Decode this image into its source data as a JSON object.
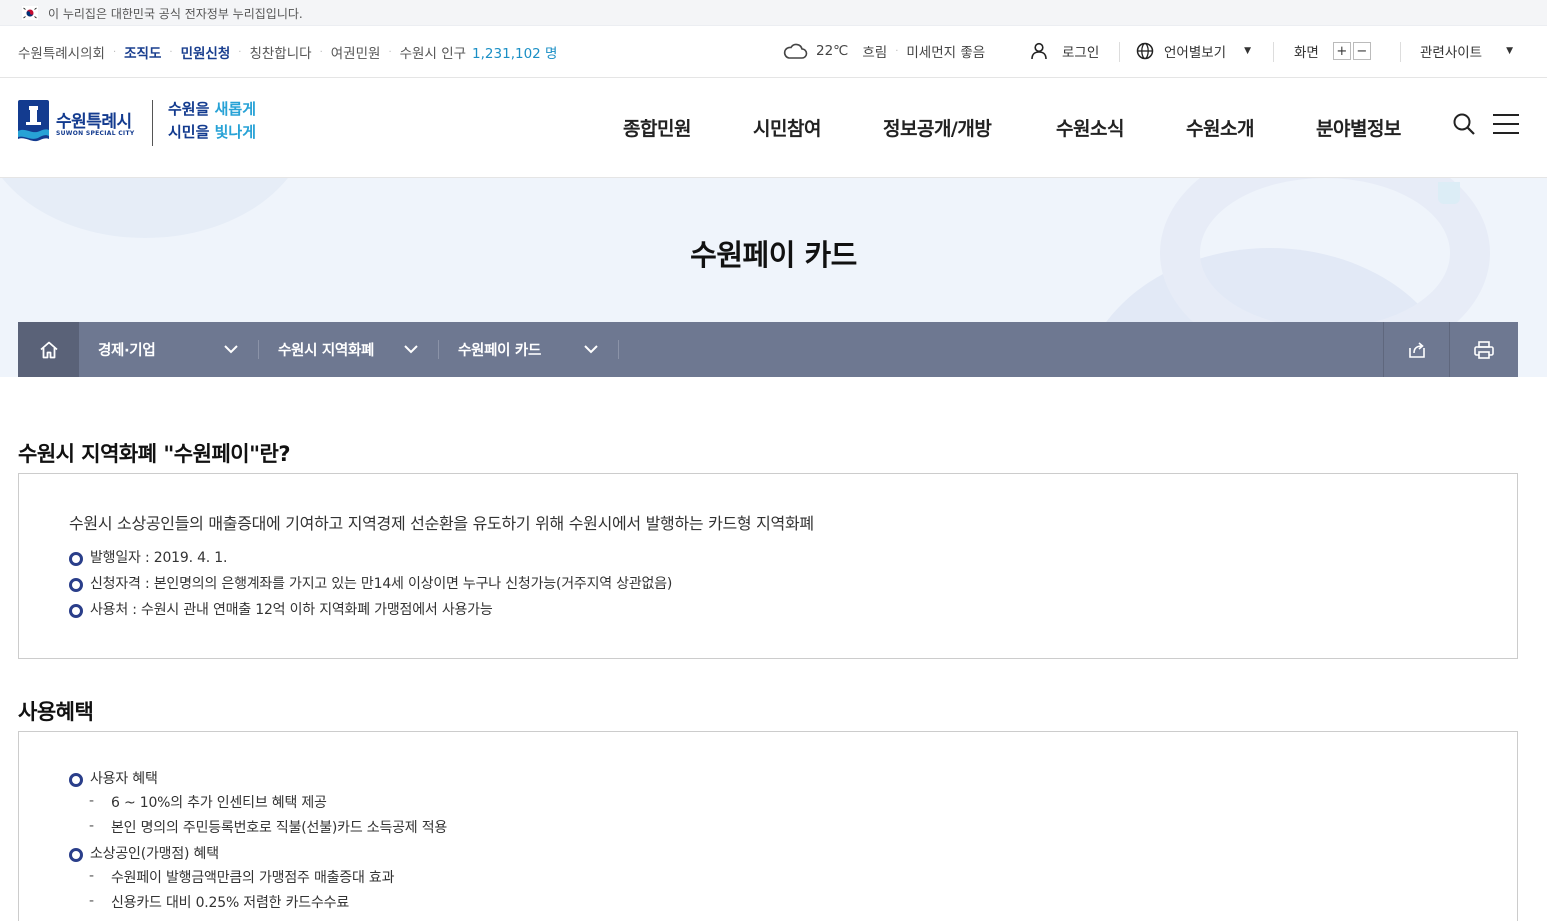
{
  "gov_banner": {
    "text": "이 누리집은 대한민국 공식 전자정부 누리집입니다."
  },
  "util": {
    "council": "수원특례시의회",
    "org_chart": "조직도",
    "civil_apply": "민원신청",
    "praise": "칭찬합니다",
    "passport": "여권민원",
    "population_label": "수원시 인구",
    "population_value": "1,231,102 명",
    "temperature": "22℃",
    "sky": "흐림",
    "dust": "미세먼지 좋음",
    "login": "로그인",
    "language": "언어별보기",
    "screen": "화면",
    "zoom_in": "+",
    "zoom_out": "−",
    "related_sites": "관련사이트"
  },
  "header": {
    "logo_name": "수원특례시",
    "logo_sub": "SUWON SPECIAL CITY",
    "slogan_line1a": "수원을 ",
    "slogan_line1b": "새롭게",
    "slogan_line2a": "시민을 ",
    "slogan_line2b": "빛나게",
    "nav": [
      "종합민원",
      "시민참여",
      "정보공개/개방",
      "수원소식",
      "수원소개",
      "분야별정보"
    ]
  },
  "page": {
    "title": "수원페이 카드"
  },
  "breadcrumb": {
    "items": [
      "경제·기업",
      "수원시 지역화폐",
      "수원페이 카드"
    ]
  },
  "section1": {
    "title": "수원시 지역화폐 \"수원페이\"란?",
    "lead": "수원시 소상공인들의 매출증대에 기여하고 지역경제 선순환을 유도하기 위해 수원시에서 발행하는 카드형 지역화폐",
    "bullets": [
      "발행일자 : 2019. 4. 1.",
      "신청자격 : 본인명의의 은행계좌를 가지고 있는 만14세 이상이면 누구나 신청가능(거주지역 상관없음)",
      "사용처 : 수원시 관내 연매출 12억 이하 지역화폐 가맹점에서 사용가능"
    ]
  },
  "section2": {
    "title": "사용혜택",
    "group1": {
      "label": "사용자 혜택",
      "items": [
        "6 ~ 10%의 추가 인센티브 혜택 제공",
        "본인 명의의 주민등록번호로 직불(선불)카드 소득공제 적용"
      ]
    },
    "group2": {
      "label": "소상공인(가맹점) 혜택",
      "items": [
        "수원페이 발행금액만큼의 가맹점주 매출증대 효과",
        "신용카드 대비 0.25% 저렴한 카드수수료"
      ]
    }
  },
  "colors": {
    "primary": "#133b8f",
    "accent": "#27a2d6",
    "loc_bar": "#6e7891",
    "bullet": "#2a3e8a"
  }
}
